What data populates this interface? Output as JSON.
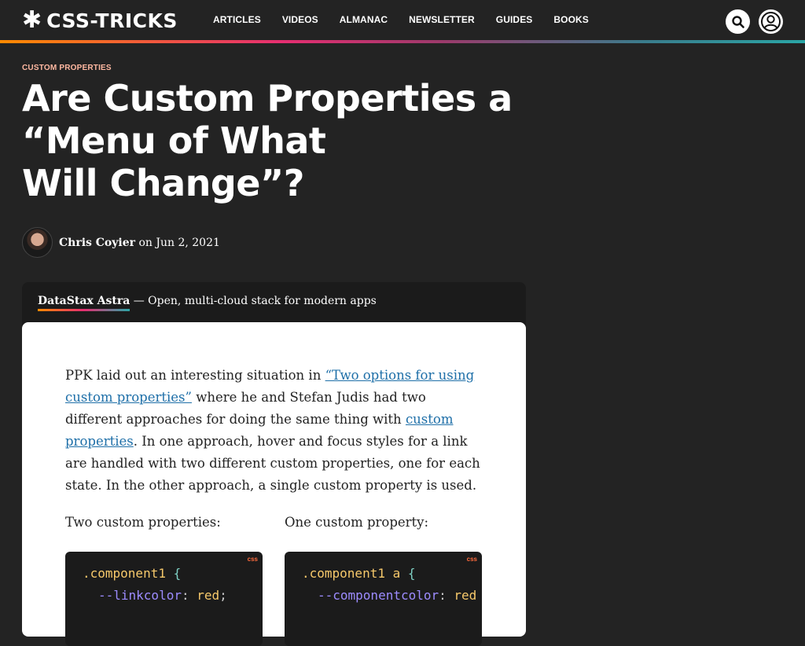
{
  "header": {
    "logo_star": "✱",
    "logo_text": "CSS-TRICKS",
    "nav": [
      "ARTICLES",
      "VIDEOS",
      "ALMANAC",
      "NEWSLETTER",
      "GUIDES",
      "BOOKS"
    ],
    "search_icon": "search-icon",
    "user_icon": "user-icon"
  },
  "article": {
    "category": "CUSTOM PROPERTIES",
    "title_line1": "Are Custom Properties a",
    "title_line2": "“Menu of What",
    "title_line3": "Will Change”?",
    "author": "Chris Coyier",
    "date_prefix": " on ",
    "date": "Jun 2, 2021"
  },
  "sponsor": {
    "name": "DataStax Astra",
    "tagline": " — Open, multi-cloud stack for modern apps"
  },
  "body": {
    "p1_a": "PPK laid out an interesting situation in ",
    "p1_link1": "“Two options for using custom properties”",
    "p1_b": " where he and Stefan Judis had two different approaches for doing the same thing with ",
    "p1_link2": "custom properties",
    "p1_c": ". In one approach, hover and focus styles for a link are handled with two different custom properties, one for each state. In the other approach, a single custom property is used.",
    "col1_label": "Two custom properties:",
    "col2_label": "One custom property:",
    "code_lang": "css",
    "code1_selector": ".component1",
    "code1_brace": "{",
    "code1_prop": "--linkcolor",
    "code1_colon": ":",
    "code1_value": "red",
    "code1_semi": ";",
    "code2_selector": ".component1 a",
    "code2_brace": "{",
    "code2_prop": "--componentcolor",
    "code2_colon": ":",
    "code2_value": "red"
  },
  "colors": {
    "background": "#232323",
    "category": "#ffb8a1",
    "link": "#1e6fa8",
    "code_bg": "#1b1b1b"
  }
}
